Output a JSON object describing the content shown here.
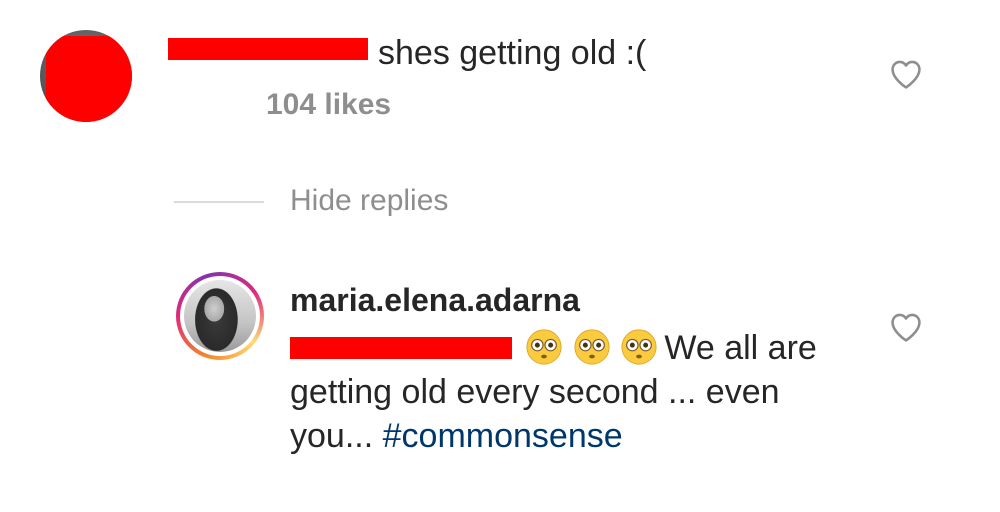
{
  "comment": {
    "text": "shes getting old :(",
    "likes": "104 likes"
  },
  "replies_toggle": {
    "label": "Hide replies"
  },
  "reply": {
    "username": "maria.elena.adarna",
    "emoji_name": "flushed-face",
    "text_after_emoji": "We all are getting old every second ... even you...",
    "hashtag": "#commonsense"
  },
  "icons": {
    "like": "heart-outline-icon"
  },
  "colors": {
    "redaction": "#ff0000",
    "secondary_text": "#8e8e8e",
    "hashtag": "#00376b",
    "story_ring": [
      "#f58529",
      "#dd2a7b",
      "#8134af",
      "#feda77"
    ]
  }
}
